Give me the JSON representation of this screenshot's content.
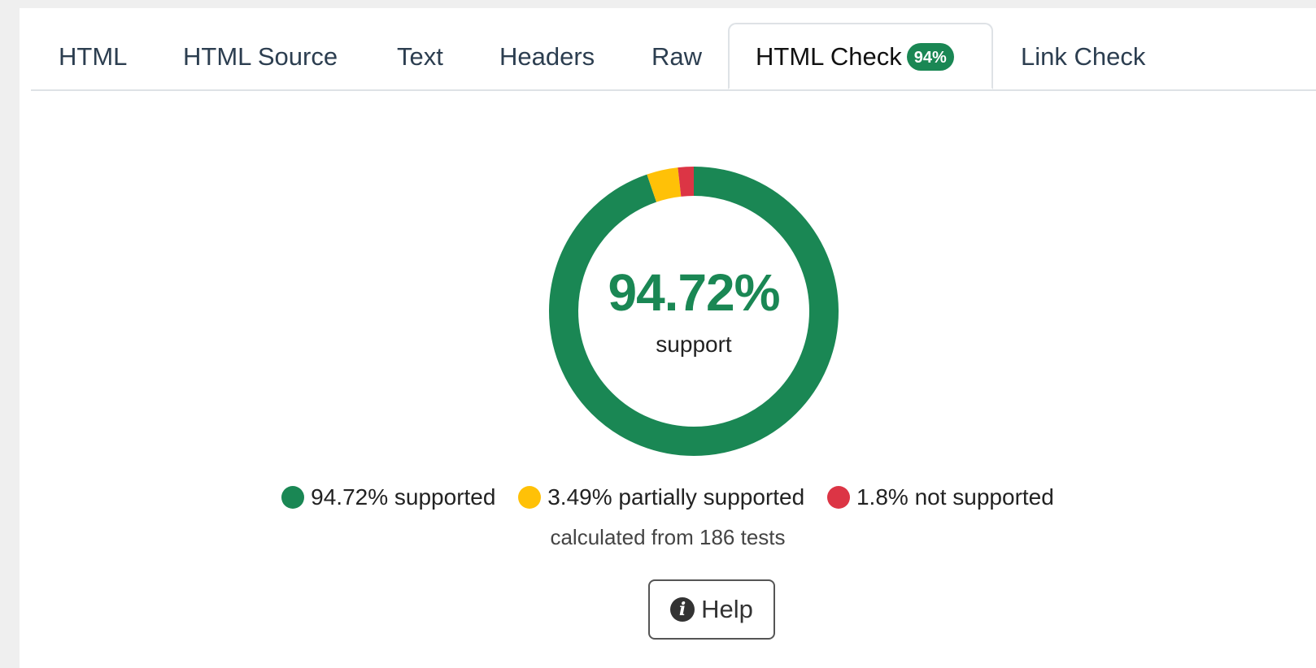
{
  "tabs": [
    {
      "label": "HTML"
    },
    {
      "label": "HTML Source"
    },
    {
      "label": "Text"
    },
    {
      "label": "Headers"
    },
    {
      "label": "Raw"
    },
    {
      "label": "HTML Check",
      "badge": "94%",
      "active": true
    },
    {
      "label": "Link Check"
    }
  ],
  "summary": {
    "value": "94.72%",
    "label": "support"
  },
  "legend": [
    {
      "text": "94.72% supported",
      "color": "#1a8754"
    },
    {
      "text": "3.49% partially supported",
      "color": "#ffc107"
    },
    {
      "text": "1.8% not supported",
      "color": "#dc3545"
    }
  ],
  "footnote": "calculated from 186 tests",
  "help": {
    "label": "Help",
    "icon": "info-icon"
  },
  "chart_data": {
    "type": "pie",
    "categories": [
      "supported",
      "partially supported",
      "not supported"
    ],
    "values": [
      94.72,
      3.49,
      1.8
    ],
    "colors": [
      "#1a8754",
      "#ffc107",
      "#dc3545"
    ]
  }
}
